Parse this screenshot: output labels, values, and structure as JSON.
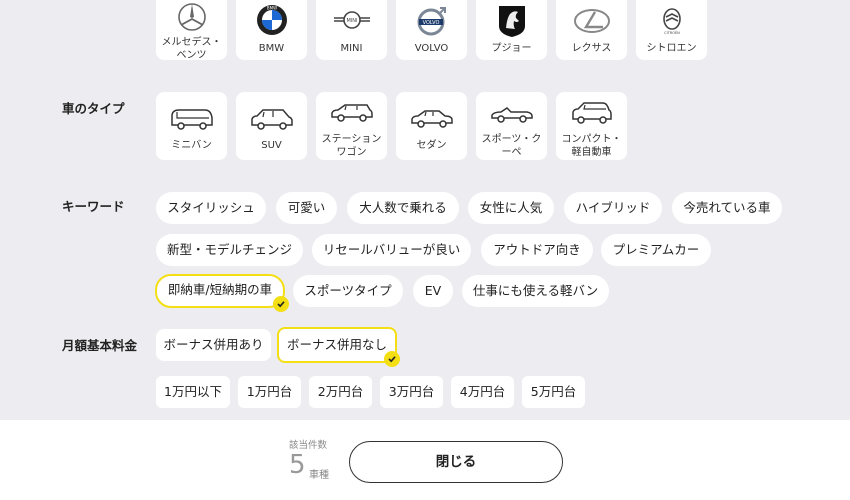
{
  "brands": [
    {
      "label": "メルセデス・\nベンツ",
      "icon": "mercedes-logo"
    },
    {
      "label": "BMW",
      "icon": "bmw-logo"
    },
    {
      "label": "MINI",
      "icon": "mini-logo"
    },
    {
      "label": "VOLVO",
      "icon": "volvo-logo"
    },
    {
      "label": "プジョー",
      "icon": "peugeot-logo"
    },
    {
      "label": "レクサス",
      "icon": "lexus-logo"
    },
    {
      "label": "シトロエン",
      "icon": "citroen-logo"
    }
  ],
  "car_types": {
    "title": "車のタイプ",
    "items": [
      {
        "label": "ミニバン",
        "icon": "minivan-icon"
      },
      {
        "label": "SUV",
        "icon": "suv-icon"
      },
      {
        "label": "ステーション\nワゴン",
        "icon": "station-wagon-icon"
      },
      {
        "label": "セダン",
        "icon": "sedan-icon"
      },
      {
        "label": "スポーツ・ク\nーペ",
        "icon": "sports-coupe-icon"
      },
      {
        "label": "コンパクト・\n軽自動車",
        "icon": "compact-car-icon"
      }
    ]
  },
  "keywords": {
    "title": "キーワード",
    "items": [
      {
        "label": "スタイリッシュ",
        "selected": false
      },
      {
        "label": "可愛い",
        "selected": false
      },
      {
        "label": "大人数で乗れる",
        "selected": false
      },
      {
        "label": "女性に人気",
        "selected": false
      },
      {
        "label": "ハイブリッド",
        "selected": false
      },
      {
        "label": "今売れている車",
        "selected": false
      },
      {
        "label": "新型・モデルチェンジ",
        "selected": false
      },
      {
        "label": "リセールバリューが良い",
        "selected": false
      },
      {
        "label": "アウトドア向き",
        "selected": false
      },
      {
        "label": "プレミアムカー",
        "selected": false
      },
      {
        "label": "即納車/短納期の車",
        "selected": true
      },
      {
        "label": "スポーツタイプ",
        "selected": false
      },
      {
        "label": "EV",
        "selected": false
      },
      {
        "label": "仕事にも使える軽バン",
        "selected": false
      }
    ]
  },
  "monthly_fee": {
    "title": "月額基本料金",
    "bonus_options": [
      {
        "label": "ボーナス併用あり",
        "selected": false
      },
      {
        "label": "ボーナス併用なし",
        "selected": true
      }
    ],
    "price_options": [
      {
        "label": "1万円以下"
      },
      {
        "label": "1万円台"
      },
      {
        "label": "2万円台"
      },
      {
        "label": "3万円台"
      },
      {
        "label": "4万円台"
      },
      {
        "label": "5万円台"
      }
    ]
  },
  "footer": {
    "count_label": "該当件数",
    "count_value": "5",
    "count_unit": "車種",
    "close_label": "閉じる"
  },
  "colors": {
    "accent": "#f3df13",
    "background": "#ededf1",
    "card": "#ffffff"
  }
}
